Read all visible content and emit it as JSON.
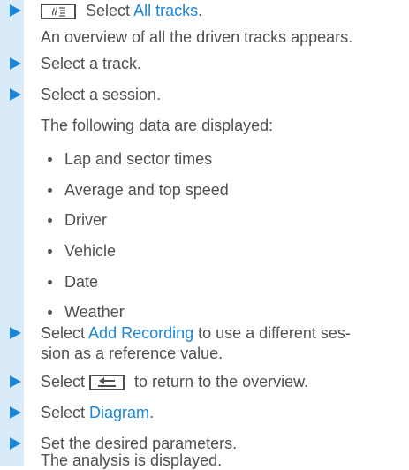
{
  "steps": [
    {
      "prefix": "Select ",
      "link": "All tracks",
      "suffix": "."
    },
    {
      "text": "An overview of all the driven tracks appears."
    },
    {
      "text": "Select a track."
    },
    {
      "text": "Select a session."
    },
    {
      "text": "The following data are displayed:"
    }
  ],
  "bullets": [
    "Lap and sector times",
    "Average and top speed",
    "Driver",
    "Vehicle",
    "Date",
    "Weather"
  ],
  "later": [
    {
      "prefix": "Select ",
      "link": "Add Recording",
      "suffix": " to use a different ses-"
    },
    {
      "text": "sion as a reference value."
    },
    {
      "prefix": "Select ",
      "suffix": " to return to the overview."
    },
    {
      "prefix": "Select ",
      "link": "Diagram",
      "suffix": "."
    },
    {
      "text": "Set the desired parameters."
    },
    {
      "text": "The analysis is displayed."
    }
  ],
  "icons": {
    "tracks_key": "track-selection-key-icon",
    "back_key": "back-key-icon",
    "arrow": "step-arrow-icon"
  },
  "colors": {
    "accent": "#1a86d8",
    "stripe": "#d9eaf8",
    "text": "#505050"
  }
}
